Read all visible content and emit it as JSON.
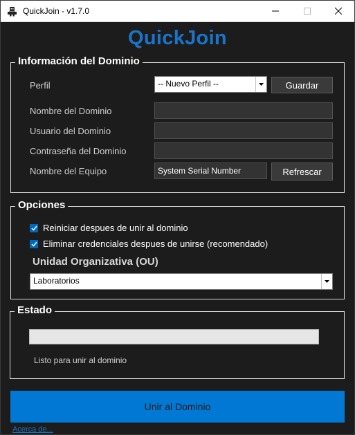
{
  "window": {
    "title": "QuickJoin - v1.7.0",
    "icons": {
      "app": "robot-icon",
      "minimize": "minimize-icon",
      "maximize": "maximize-icon",
      "close": "close-icon"
    }
  },
  "header": {
    "title": "QuickJoin"
  },
  "domain_info": {
    "group_title": "Información del Dominio",
    "profile_label": "Perfil",
    "profile_selected": "-- Nuevo Perfil --",
    "save_label": "Guardar",
    "domain_name_label": "Nombre del Dominio",
    "domain_name_value": "",
    "domain_user_label": "Usuario del Dominio",
    "domain_user_value": "",
    "domain_password_label": "Contraseña del Dominio",
    "domain_password_value": "",
    "computer_name_label": "Nombre del Equipo",
    "computer_name_value": "System Serial Number",
    "refresh_label": "Refrescar"
  },
  "options": {
    "group_title": "Opciones",
    "restart_label": "Reiniciar despues de unir al dominio",
    "restart_checked": true,
    "remove_creds_label": "Eliminar credenciales despues de unirse (recomendado)",
    "remove_creds_checked": true,
    "ou_label": "Unidad Organizativa (OU)",
    "ou_selected": "Laboratorios"
  },
  "status": {
    "group_title": "Estado",
    "progress": 0,
    "message": "Listo para unir al dominio"
  },
  "actions": {
    "join_label": "Unir al Dominio",
    "about_label": "Acerca de..."
  },
  "colors": {
    "accent": "#0078d4",
    "title_blue": "#1a74c9",
    "background": "#1c1c1c",
    "checkbox": "#0067c0"
  }
}
